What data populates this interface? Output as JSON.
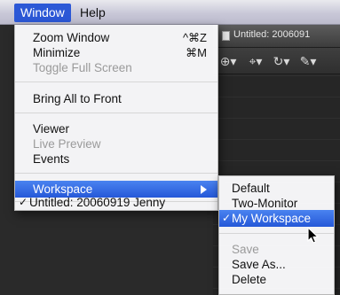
{
  "menubar": {
    "items": [
      {
        "label": "Window",
        "active": true
      },
      {
        "label": "Help",
        "active": false
      }
    ]
  },
  "window_menu": {
    "items": [
      {
        "label": "Zoom Window",
        "shortcut": "^⌘Z",
        "enabled": true
      },
      {
        "label": "Minimize",
        "shortcut": "⌘M",
        "enabled": true
      },
      {
        "label": "Toggle Full Screen",
        "shortcut": "",
        "enabled": false
      },
      {
        "label": "Bring All to Front",
        "shortcut": "",
        "enabled": true
      },
      {
        "label": "Viewer",
        "shortcut": "",
        "enabled": true
      },
      {
        "label": "Live Preview",
        "shortcut": "",
        "enabled": false
      },
      {
        "label": "Events",
        "shortcut": "",
        "enabled": true
      },
      {
        "label": "Workspace",
        "shortcut": "",
        "enabled": true,
        "highlighted": true,
        "has_submenu": true
      },
      {
        "label": "Untitled: 20060919 Jenny",
        "shortcut": "",
        "enabled": true,
        "checked": true
      }
    ]
  },
  "workspace_submenu": {
    "items": [
      {
        "label": "Default",
        "enabled": true
      },
      {
        "label": "Two-Monitor",
        "enabled": true
      },
      {
        "label": "My Workspace",
        "enabled": true,
        "checked": true,
        "highlighted": true
      },
      {
        "label": "Save",
        "enabled": false
      },
      {
        "label": "Save As...",
        "enabled": true
      },
      {
        "label": "Delete",
        "enabled": true
      }
    ]
  },
  "background_window": {
    "title": "Untitled: 2006091",
    "toolbar_icons": [
      "zoom-icon",
      "crop-icon",
      "rotate-icon",
      "brush-icon"
    ]
  },
  "colors": {
    "menu_highlight": "#2c58d6",
    "menu_background": "#f8f8fa",
    "disabled_text": "#9a9a9a",
    "app_background": "#2a2a2a"
  }
}
